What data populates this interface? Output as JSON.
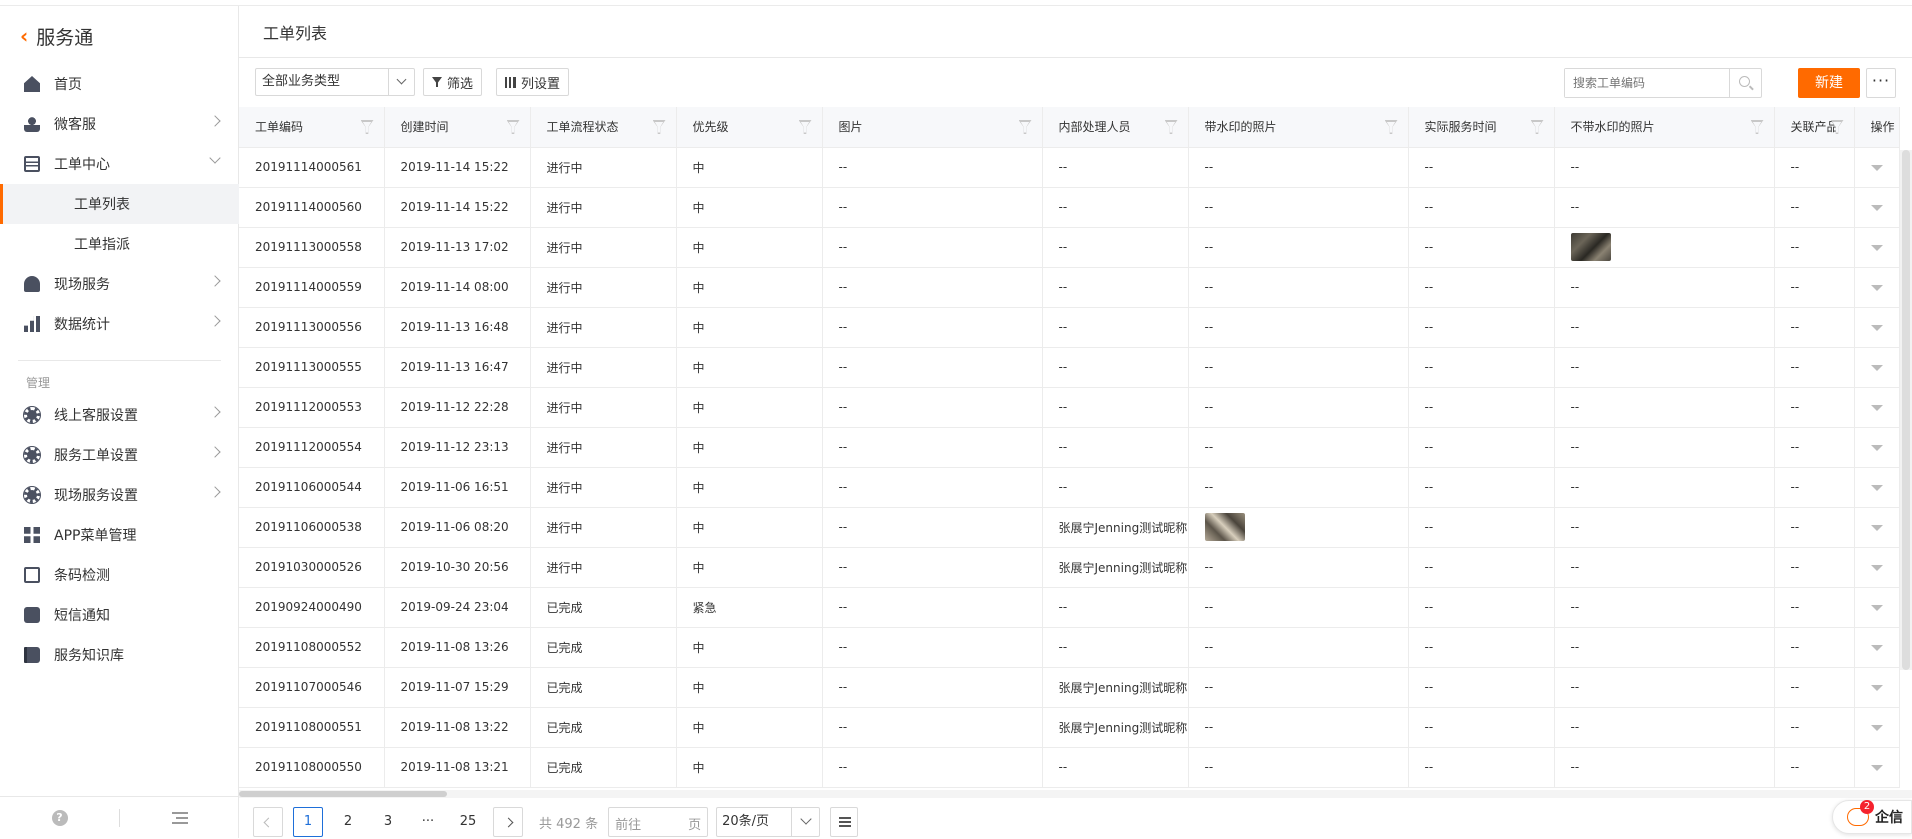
{
  "app": {
    "name": "服务通",
    "back_icon": "back-chevron-icon"
  },
  "sidebar": {
    "items": [
      {
        "label": "首页",
        "icon": "home-icon",
        "hasChevron": false
      },
      {
        "label": "微客服",
        "icon": "user-service-icon",
        "hasChevron": true
      },
      {
        "label": "工单中心",
        "icon": "document-icon",
        "hasChevron": true,
        "expanded": true
      },
      {
        "label": "工单列表",
        "sub": true,
        "active": true
      },
      {
        "label": "工单指派",
        "sub": true
      },
      {
        "label": "现场服务",
        "icon": "helmet-icon",
        "hasChevron": true
      },
      {
        "label": "数据统计",
        "icon": "bar-chart-icon",
        "hasChevron": true
      }
    ],
    "section_label": "管理",
    "manage_items": [
      {
        "label": "线上客服设置",
        "icon": "gear-icon",
        "hasChevron": true
      },
      {
        "label": "服务工单设置",
        "icon": "gear-icon",
        "hasChevron": true
      },
      {
        "label": "现场服务设置",
        "icon": "gear-icon",
        "hasChevron": true
      },
      {
        "label": "APP菜单管理",
        "icon": "grid-icon",
        "hasChevron": false
      },
      {
        "label": "条码检测",
        "icon": "barcode-icon",
        "hasChevron": false
      },
      {
        "label": "短信通知",
        "icon": "sms-icon",
        "hasChevron": false
      },
      {
        "label": "服务知识库",
        "icon": "book-icon",
        "hasChevron": false
      }
    ]
  },
  "page": {
    "title": "工单列表"
  },
  "toolbar": {
    "business_type": "全部业务类型",
    "filter_label": "筛选",
    "columns_label": "列设置",
    "search_placeholder": "搜索工单编码",
    "new_label": "新建",
    "more_label": "···"
  },
  "table": {
    "columns": [
      "工单编码",
      "创建时间",
      "工单流程状态",
      "优先级",
      "图片",
      "内部处理人员",
      "带水印的照片",
      "实际服务时间",
      "不带水印的照片",
      "关联产品",
      "操作"
    ],
    "rows": [
      {
        "code": "20191114000561",
        "time": "2019-11-14 15:22",
        "status": "进行中",
        "priority": "中",
        "image": "--",
        "staff": "--",
        "wm_photo": "--",
        "service_time": "--",
        "nowm_photo": "--",
        "product": "--"
      },
      {
        "code": "20191114000560",
        "time": "2019-11-14 15:22",
        "status": "进行中",
        "priority": "中",
        "image": "--",
        "staff": "--",
        "wm_photo": "--",
        "service_time": "--",
        "nowm_photo": "--",
        "product": "--"
      },
      {
        "code": "20191113000558",
        "time": "2019-11-13 17:02",
        "status": "进行中",
        "priority": "中",
        "image": "--",
        "staff": "--",
        "wm_photo": "--",
        "service_time": "--",
        "nowm_photo": "",
        "nowm_thumb": true,
        "product": "--"
      },
      {
        "code": "20191114000559",
        "time": "2019-11-14 08:00",
        "status": "进行中",
        "priority": "中",
        "image": "--",
        "staff": "--",
        "wm_photo": "--",
        "service_time": "--",
        "nowm_photo": "--",
        "product": "--"
      },
      {
        "code": "20191113000556",
        "time": "2019-11-13 16:48",
        "status": "进行中",
        "priority": "中",
        "image": "--",
        "staff": "--",
        "wm_photo": "--",
        "service_time": "--",
        "nowm_photo": "--",
        "product": "--"
      },
      {
        "code": "20191113000555",
        "time": "2019-11-13 16:47",
        "status": "进行中",
        "priority": "中",
        "image": "--",
        "staff": "--",
        "wm_photo": "--",
        "service_time": "--",
        "nowm_photo": "--",
        "product": "--"
      },
      {
        "code": "20191112000553",
        "time": "2019-11-12 22:28",
        "status": "进行中",
        "priority": "中",
        "image": "--",
        "staff": "--",
        "wm_photo": "--",
        "service_time": "--",
        "nowm_photo": "--",
        "product": "--"
      },
      {
        "code": "20191112000554",
        "time": "2019-11-12 23:13",
        "status": "进行中",
        "priority": "中",
        "image": "--",
        "staff": "--",
        "wm_photo": "--",
        "service_time": "--",
        "nowm_photo": "--",
        "product": "--"
      },
      {
        "code": "20191106000544",
        "time": "2019-11-06 16:51",
        "status": "进行中",
        "priority": "中",
        "image": "--",
        "staff": "--",
        "wm_photo": "--",
        "service_time": "--",
        "nowm_photo": "--",
        "product": "--"
      },
      {
        "code": "20191106000538",
        "time": "2019-11-06 08:20",
        "status": "进行中",
        "priority": "中",
        "image": "--",
        "staff": "张展宁Jenning测试昵称",
        "wm_photo": "",
        "wm_thumb": true,
        "service_time": "--",
        "nowm_photo": "--",
        "product": "--"
      },
      {
        "code": "20191030000526",
        "time": "2019-10-30 20:56",
        "status": "进行中",
        "priority": "中",
        "image": "--",
        "staff": "张展宁Jenning测试昵称",
        "wm_photo": "--",
        "service_time": "--",
        "nowm_photo": "--",
        "product": "--"
      },
      {
        "code": "20190924000490",
        "time": "2019-09-24 23:04",
        "status": "已完成",
        "priority": "紧急",
        "image": "--",
        "staff": "--",
        "wm_photo": "--",
        "service_time": "--",
        "nowm_photo": "--",
        "product": "--"
      },
      {
        "code": "20191108000552",
        "time": "2019-11-08 13:26",
        "status": "已完成",
        "priority": "中",
        "image": "--",
        "staff": "--",
        "wm_photo": "--",
        "service_time": "--",
        "nowm_photo": "--",
        "product": "--"
      },
      {
        "code": "20191107000546",
        "time": "2019-11-07 15:29",
        "status": "已完成",
        "priority": "中",
        "image": "--",
        "staff": "张展宁Jenning测试昵称",
        "wm_photo": "--",
        "service_time": "--",
        "nowm_photo": "--",
        "product": "--"
      },
      {
        "code": "20191108000551",
        "time": "2019-11-08 13:22",
        "status": "已完成",
        "priority": "中",
        "image": "--",
        "staff": "张展宁Jenning测试昵称",
        "wm_photo": "--",
        "service_time": "--",
        "nowm_photo": "--",
        "product": "--"
      },
      {
        "code": "20191108000550",
        "time": "2019-11-08 13:21",
        "status": "已完成",
        "priority": "中",
        "image": "--",
        "staff": "--",
        "wm_photo": "--",
        "service_time": "--",
        "nowm_photo": "--",
        "product": "--"
      }
    ]
  },
  "pagination": {
    "pages": [
      "1",
      "2",
      "3",
      "···",
      "25"
    ],
    "current": "1",
    "total_text": "共 492 条",
    "jump_prefix": "前往",
    "jump_suffix": "页",
    "page_size": "20条/页"
  },
  "qixin": {
    "label": "企信",
    "badge": "2"
  },
  "colors": {
    "accent": "#ff6a00",
    "active_page": "#1e6fd9"
  }
}
